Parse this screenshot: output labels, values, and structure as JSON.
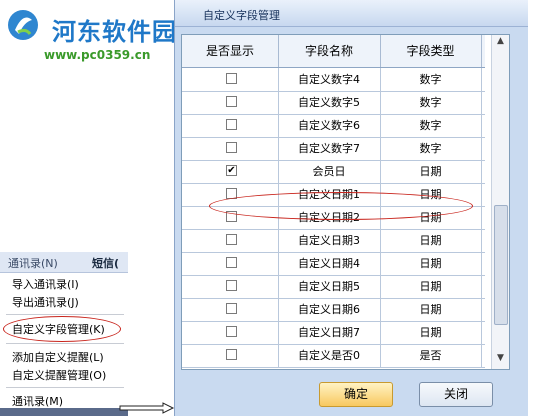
{
  "watermark": {
    "name": "河东软件园",
    "url": "www.pc0359.cn"
  },
  "menu": {
    "bar_items": [
      "通讯录(N)",
      "短信("
    ],
    "items": [
      "导入通讯录(I)",
      "导出通讯录(J)",
      "自定义字段管理(K)",
      "添加自定义提醒(L)",
      "自定义提醒管理(O)",
      "通讯录(M)"
    ]
  },
  "dialog": {
    "title": "自定义字段管理",
    "columns": [
      "是否显示",
      "字段名称",
      "字段类型"
    ],
    "rows": [
      {
        "checked": false,
        "name": "自定义数字4",
        "type": "数字"
      },
      {
        "checked": false,
        "name": "自定义数字5",
        "type": "数字"
      },
      {
        "checked": false,
        "name": "自定义数字6",
        "type": "数字"
      },
      {
        "checked": false,
        "name": "自定义数字7",
        "type": "数字"
      },
      {
        "checked": true,
        "name": "会员日",
        "type": "日期"
      },
      {
        "checked": false,
        "name": "自定义日期1",
        "type": "日期"
      },
      {
        "checked": false,
        "name": "自定义日期2",
        "type": "日期"
      },
      {
        "checked": false,
        "name": "自定义日期3",
        "type": "日期"
      },
      {
        "checked": false,
        "name": "自定义日期4",
        "type": "日期"
      },
      {
        "checked": false,
        "name": "自定义日期5",
        "type": "日期"
      },
      {
        "checked": false,
        "name": "自定义日期6",
        "type": "日期"
      },
      {
        "checked": false,
        "name": "自定义日期7",
        "type": "日期"
      },
      {
        "checked": false,
        "name": "自定义是否0",
        "type": "是否"
      }
    ],
    "ok_label": "确定",
    "close_label": "关闭"
  },
  "colors": {
    "highlight": "#c8241c",
    "ok_button": "#f8c860",
    "title_text": "#15305a"
  }
}
